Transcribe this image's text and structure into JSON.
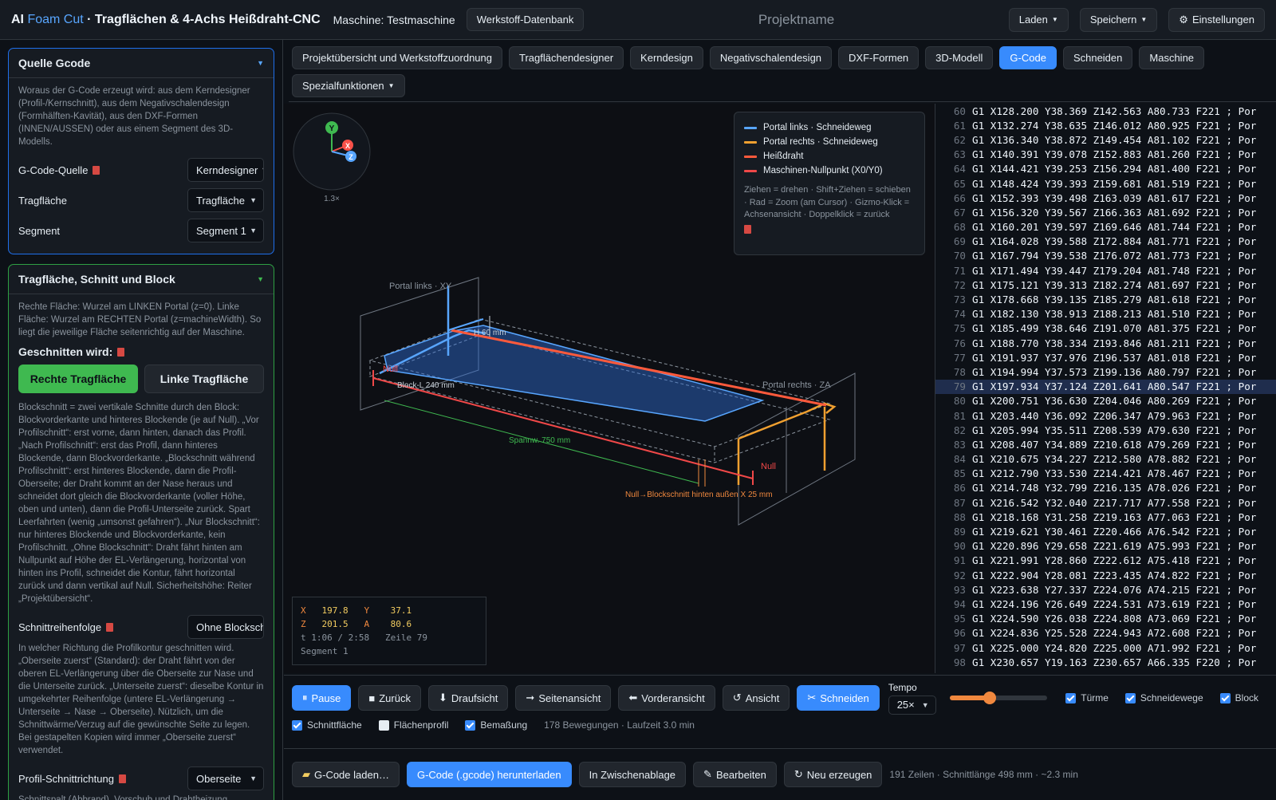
{
  "header": {
    "brand_prefix": "AI ",
    "brand_accent": "Foam Cut",
    "brand_suffix": " · Tragflächen & 4-Achs Heißdraht-CNC",
    "machine": "Maschine: Testmaschine",
    "db_button": "Werkstoff-Datenbank",
    "project_name": "Projektname",
    "load": "Laden",
    "save": "Speichern",
    "settings": "Einstellungen"
  },
  "left": {
    "source": {
      "title": "Quelle Gcode",
      "desc": "Woraus der G-Code erzeugt wird: aus dem Kerndesigner (Profil-/Kernschnitt), aus dem Negativschalendesign (Formhälften-Kavität), aus den DXF-Formen (INNEN/AUSSEN) oder aus einem Segment des 3D-Modells.",
      "rows": [
        {
          "label": "G-Code-Quelle",
          "value": "Kerndesigner"
        },
        {
          "label": "Tragfläche",
          "value": "Tragfläche"
        },
        {
          "label": "Segment",
          "value": "Segment 1"
        }
      ]
    },
    "block": {
      "title": "Tragfläche, Schnitt und Block",
      "desc": "Rechte Fläche: Wurzel am LINKEN Portal (z=0). Linke Fläche: Wurzel am RECHTEN Portal (z=machineWidth). So liegt die jeweilige Fläche seitenrichtig auf der Maschine.",
      "cut_title": "Geschnitten wird:",
      "right_wing": "Rechte Tragfläche",
      "left_wing": "Linke Tragfläche",
      "block_desc": "Blockschnitt = zwei vertikale Schnitte durch den Block: Blockvorderkante und hinteres Blockende (je auf Null). „Vor Profilschnitt“: erst vorne, dann hinten, danach das Profil. „Nach Profilschnitt“: erst das Profil, dann hinteres Blockende, dann Blockvorderkante. „Blockschnitt während Profilschnitt“: erst hinteres Blockende, dann die Profil-Oberseite; der Draht kommt an der Nase heraus und schneidet dort gleich die Blockvorderkante (voller Höhe, oben und unten), dann die Profil-Unterseite zurück. Spart Leerfahrten (wenig „umsonst gefahren“). „Nur Blockschnitt“: nur hinteres Blockende und Blockvorderkante, kein Profilschnitt. „Ohne Blockschnitt“: Draht fährt hinten am Nullpunkt auf Höhe der EL-Verlängerung, horizontal von hinten ins Profil, schneidet die Kontur, fährt horizontal zurück und dann vertikal auf Null. Sicherheitshöhe: Reiter „Projektübersicht“.",
      "order_label": "Schnittreihenfolge",
      "order_value": "Ohne Blockschnitt",
      "dir_desc": "In welcher Richtung die Profilkontur geschnitten wird. „Oberseite zuerst“ (Standard): der Draht fährt von der oberen EL-Verlängerung über die Oberseite zur Nase und die Unterseite zurück. „Unterseite zuerst“: dieselbe Kontur in umgekehrter Reihenfolge (untere EL-Verlängerung → Unterseite → Nase → Oberseite). Nützlich, um die Schnittwärme/Verzug auf die gewünschte Seite zu legen. Bei gestapelten Kopien wird immer „Oberseite zuerst“ verwendet.",
      "dir_label": "Profil-Schnittrichtung",
      "dir_value": "Oberseite",
      "kerf_desc": "Schnittspalt (Abbrand), Vorschub und Drahtheizung kommen aus dem Werkstoff-Betriebspunkt (Reiter"
    }
  },
  "tabs": [
    "Projektübersicht und Werkstoffzuordnung",
    "Tragflächendesigner",
    "Kerndesign",
    "Negativschalendesign",
    "DXF-Formen",
    "3D-Modell",
    "G-Code",
    "Schneiden",
    "Maschine",
    "Spezialfunktionen"
  ],
  "active_tab": "G-Code",
  "viewport": {
    "gizmo": {
      "y": "Y",
      "x": "X",
      "z": "Z",
      "zoom": "1.3×"
    },
    "legend": [
      {
        "label": "Portal links · Schneideweg",
        "color": "#58a6ff"
      },
      {
        "label": "Portal rechts · Schneideweg",
        "color": "#f0a030"
      },
      {
        "label": "Heißdraht",
        "color": "#ff5a3c"
      },
      {
        "label": "Maschinen-Nullpunkt (X0/Y0)",
        "color": "#f04848"
      }
    ],
    "hint": "Ziehen = drehen · Shift+Ziehen = schieben · Rad = Zoom (am Cursor) · Gizmo-Klick = Achsenansicht · Doppelklick = zurück",
    "labels": {
      "portal_left": "Portal links · XY",
      "portal_right": "Portal rechts · ZA",
      "height": "H 60 mm",
      "block": "Block-L 240 mm",
      "span": "Spannw. 750 mm",
      "null1": "Null",
      "null2": "Null",
      "null_block": "Null→Blockschnitt hinten außen X 25 mm"
    },
    "readout": {
      "x_label": "X",
      "x": "197.8",
      "y_label": "Y",
      "y": "37.1",
      "z_label": "Z",
      "z": "201.5",
      "a_label": "A",
      "a": "80.6",
      "time": "t 1:06 / 2:58",
      "line": "Zeile 79",
      "segment": "Segment 1"
    }
  },
  "gcode": {
    "active_line": 79,
    "lines": [
      {
        "n": "60",
        "t": "G1 X128.200 Y38.369 Z142.563 A80.733 F221 ; Por"
      },
      {
        "n": "61",
        "t": "G1 X132.274 Y38.635 Z146.012 A80.925 F221 ; Por"
      },
      {
        "n": "62",
        "t": "G1 X136.340 Y38.872 Z149.454 A81.102 F221 ; Por"
      },
      {
        "n": "63",
        "t": "G1 X140.391 Y39.078 Z152.883 A81.260 F221 ; Por"
      },
      {
        "n": "64",
        "t": "G1 X144.421 Y39.253 Z156.294 A81.400 F221 ; Por"
      },
      {
        "n": "65",
        "t": "G1 X148.424 Y39.393 Z159.681 A81.519 F221 ; Por"
      },
      {
        "n": "66",
        "t": "G1 X152.393 Y39.498 Z163.039 A81.617 F221 ; Por"
      },
      {
        "n": "67",
        "t": "G1 X156.320 Y39.567 Z166.363 A81.692 F221 ; Por"
      },
      {
        "n": "68",
        "t": "G1 X160.201 Y39.597 Z169.646 A81.744 F221 ; Por"
      },
      {
        "n": "69",
        "t": "G1 X164.028 Y39.588 Z172.884 A81.771 F221 ; Por"
      },
      {
        "n": "70",
        "t": "G1 X167.794 Y39.538 Z176.072 A81.773 F221 ; Por"
      },
      {
        "n": "71",
        "t": "G1 X171.494 Y39.447 Z179.204 A81.748 F221 ; Por"
      },
      {
        "n": "72",
        "t": "G1 X175.121 Y39.313 Z182.274 A81.697 F221 ; Por"
      },
      {
        "n": "73",
        "t": "G1 X178.668 Y39.135 Z185.279 A81.618 F221 ; Por"
      },
      {
        "n": "74",
        "t": "G1 X182.130 Y38.913 Z188.213 A81.510 F221 ; Por"
      },
      {
        "n": "75",
        "t": "G1 X185.499 Y38.646 Z191.070 A81.375 F221 ; Por"
      },
      {
        "n": "76",
        "t": "G1 X188.770 Y38.334 Z193.846 A81.211 F221 ; Por"
      },
      {
        "n": "77",
        "t": "G1 X191.937 Y37.976 Z196.537 A81.018 F221 ; Por"
      },
      {
        "n": "78",
        "t": "G1 X194.994 Y37.573 Z199.136 A80.797 F221 ; Por"
      },
      {
        "n": "79",
        "t": "G1 X197.934 Y37.124 Z201.641 A80.547 F221 ; Por"
      },
      {
        "n": "80",
        "t": "G1 X200.751 Y36.630 Z204.046 A80.269 F221 ; Por"
      },
      {
        "n": "81",
        "t": "G1 X203.440 Y36.092 Z206.347 A79.963 F221 ; Por"
      },
      {
        "n": "82",
        "t": "G1 X205.994 Y35.511 Z208.539 A79.630 F221 ; Por"
      },
      {
        "n": "83",
        "t": "G1 X208.407 Y34.889 Z210.618 A79.269 F221 ; Por"
      },
      {
        "n": "84",
        "t": "G1 X210.675 Y34.227 Z212.580 A78.882 F221 ; Por"
      },
      {
        "n": "85",
        "t": "G1 X212.790 Y33.530 Z214.421 A78.467 F221 ; Por"
      },
      {
        "n": "86",
        "t": "G1 X214.748 Y32.799 Z216.135 A78.026 F221 ; Por"
      },
      {
        "n": "87",
        "t": "G1 X216.542 Y32.040 Z217.717 A77.558 F221 ; Por"
      },
      {
        "n": "88",
        "t": "G1 X218.168 Y31.258 Z219.163 A77.063 F221 ; Por"
      },
      {
        "n": "89",
        "t": "G1 X219.621 Y30.461 Z220.466 A76.542 F221 ; Por"
      },
      {
        "n": "90",
        "t": "G1 X220.896 Y29.658 Z221.619 A75.993 F221 ; Por"
      },
      {
        "n": "91",
        "t": "G1 X221.991 Y28.860 Z222.612 A75.418 F221 ; Por"
      },
      {
        "n": "92",
        "t": "G1 X222.904 Y28.081 Z223.435 A74.822 F221 ; Por"
      },
      {
        "n": "93",
        "t": "G1 X223.638 Y27.337 Z224.076 A74.215 F221 ; Por"
      },
      {
        "n": "94",
        "t": "G1 X224.196 Y26.649 Z224.531 A73.619 F221 ; Por"
      },
      {
        "n": "95",
        "t": "G1 X224.590 Y26.038 Z224.808 A73.069 F221 ; Por"
      },
      {
        "n": "96",
        "t": "G1 X224.836 Y25.528 Z224.943 A72.608 F221 ; Por"
      },
      {
        "n": "97",
        "t": "G1 X225.000 Y24.820 Z225.000 A71.992 F221 ; Por"
      },
      {
        "n": "98",
        "t": "G1 X230.657 Y19.163 Z230.657 A66.335 F220 ; Por"
      }
    ]
  },
  "controls": {
    "pause": "Pause",
    "back": "Zurück",
    "top": "Draufsicht",
    "side": "Seitenansicht",
    "front": "Vorderansicht",
    "view": "Ansicht",
    "cut": "Schneiden",
    "tempo_label": "Tempo",
    "tempo_value": "25×",
    "tempo_fraction": 0.41,
    "checks_row1": [
      {
        "label": "Türme",
        "on": true
      },
      {
        "label": "Schneidewege",
        "on": true
      },
      {
        "label": "Block",
        "on": true
      }
    ],
    "checks_row2": [
      {
        "label": "Schnittfläche",
        "on": true
      },
      {
        "label": "Flächenprofil",
        "on": false
      },
      {
        "label": "Bemaßung",
        "on": true
      }
    ],
    "meta": "178 Bewegungen · Laufzeit 3.0 min"
  },
  "bottom": {
    "load": "G-Code laden…",
    "download": "G-Code (.gcode) herunterladen",
    "clipboard": "In Zwischenablage",
    "edit": "Bearbeiten",
    "regen": "Neu erzeugen",
    "meta": "191 Zeilen · Schnittlänge 498 mm · ~2.3 min"
  }
}
